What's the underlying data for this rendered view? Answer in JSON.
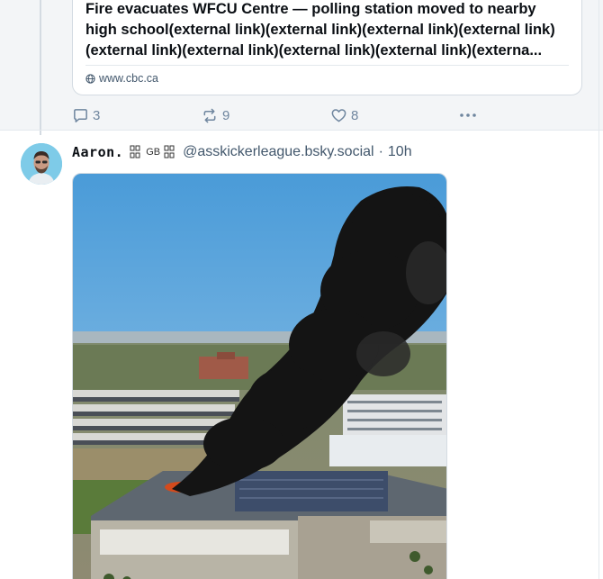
{
  "previous_post": {
    "link_card": {
      "title_lines": [
        "Fire evacuates WFCU Centre — polling station moved to nearby",
        "high school(external link)(external link)(external link)(external link)",
        "(external link)(external link)(external link)(external link)(externa..."
      ],
      "domain": "www.cbc.ca",
      "domain_icon": "globe-icon"
    },
    "actions": {
      "reply_count": "3",
      "repost_count": "9",
      "like_count": "8",
      "reply_icon": "reply-icon",
      "repost_icon": "repost-icon",
      "like_icon": "heart-icon",
      "more_icon": "more-icon"
    }
  },
  "post": {
    "display_name": "Aaron.",
    "flag_label": "GB",
    "handle": "@asskickerleague.bsky.social",
    "separator": "·",
    "time": "10h",
    "media_icon": "fire-smoke-photo"
  },
  "colors": {
    "accent_text": "#42576c",
    "icon_gray": "#6f869f",
    "border": "#d4dbe2",
    "sky": "#5ba6dc"
  }
}
